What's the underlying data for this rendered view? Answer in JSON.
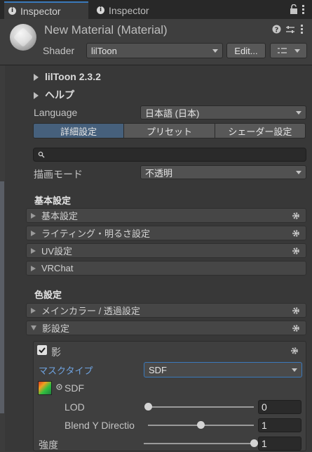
{
  "tabs": [
    {
      "label": "Inspector"
    },
    {
      "label": "Inspector"
    }
  ],
  "header": {
    "material_title": "New Material (Material)",
    "shader_label": "Shader",
    "shader_value": "lilToon",
    "edit_label": "Edit..."
  },
  "sections": {
    "liltoon_version": "lilToon 2.3.2",
    "help": "ヘルプ",
    "language_label": "Language",
    "language_value": "日本語 (日本)",
    "top_tabs": [
      "詳細設定",
      "プリセット",
      "シェーダー設定"
    ],
    "render_mode_label": "描画モード",
    "render_mode_value": "不透明",
    "basic_title": "基本設定",
    "basic_folds": [
      "基本設定",
      "ライティング・明るさ設定",
      "UV設定",
      "VRChat"
    ],
    "color_title": "色設定",
    "color_folds": [
      "メインカラー / 透過設定",
      "影設定"
    ]
  },
  "shadow": {
    "enable_label": "影",
    "mask_type_label": "マスクタイプ",
    "mask_type_value": "SDF",
    "sdf_label": "SDF",
    "lod_label": "LOD",
    "lod_value": "0",
    "lod_fraction": 0.0,
    "blend_label": "Blend Y Directio",
    "blend_value": "1",
    "blend_fraction": 0.5,
    "strength_label": "強度",
    "strength_value": "1",
    "strength_fraction": 1.0
  },
  "colors": {
    "accent": "#3a79bb",
    "selected_tab": "#46607c",
    "mask_label": "#6fa3e0"
  }
}
